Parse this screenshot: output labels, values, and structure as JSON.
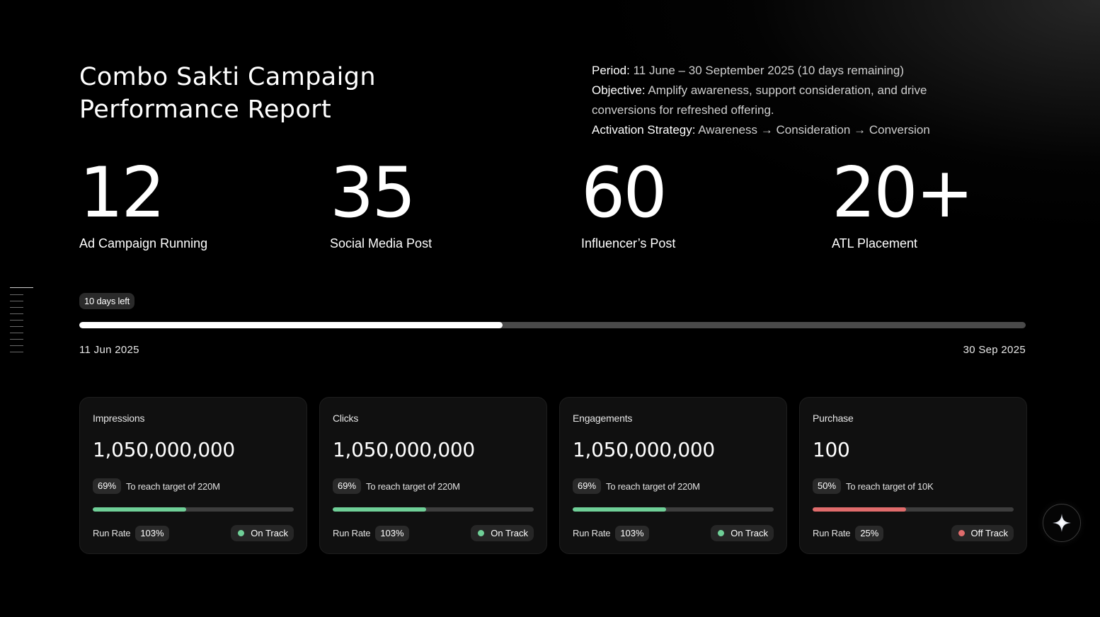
{
  "header": {
    "title_line1": "Combo Sakti Campaign",
    "title_line2": "Performance Report",
    "period_label": "Period:",
    "period_value": " 11 June – 30 September 2025 (10 days remaining)",
    "objective_label": "Objective:",
    "objective_value": " Amplify awareness, support consideration, and drive conversions for refreshed offering.",
    "strategy_label": "Activation Strategy:",
    "strategy_value": " Awareness → Consideration → Conversion"
  },
  "stats": [
    {
      "number": "12",
      "label": "Ad Campaign Running"
    },
    {
      "number": "35",
      "label": "Social Media Post"
    },
    {
      "number": "60",
      "label": "Influencer’s Post"
    },
    {
      "number": "20+",
      "label": "ATL Placement"
    }
  ],
  "timeline": {
    "days_left": "10 days left",
    "start_date": "11 Jun 2025",
    "end_date": "30 Sep 2025",
    "progress": 0.447
  },
  "cards": [
    {
      "title": "Impressions",
      "value": "1,050,000,000",
      "percent": "69%",
      "target": "To reach target of 220M",
      "progress": 0.465,
      "run_rate_label": "Run Rate",
      "run_rate": "103%",
      "status": "On Track",
      "color": "#6fcf97"
    },
    {
      "title": "Clicks",
      "value": "1,050,000,000",
      "percent": "69%",
      "target": "To reach target of 220M",
      "progress": 0.465,
      "run_rate_label": "Run Rate",
      "run_rate": "103%",
      "status": "On Track",
      "color": "#6fcf97"
    },
    {
      "title": "Engagements",
      "value": "1,050,000,000",
      "percent": "69%",
      "target": "To reach target of 220M",
      "progress": 0.465,
      "run_rate_label": "Run Rate",
      "run_rate": "103%",
      "status": "On Track",
      "color": "#6fcf97"
    },
    {
      "title": "Purchase",
      "value": "100",
      "percent": "50%",
      "target": "To reach target of 10K",
      "progress": 0.465,
      "run_rate_label": "Run Rate",
      "run_rate": "25%",
      "status": "Off Track",
      "color": "#e06c6c"
    }
  ],
  "assistant_button": {
    "icon": "sparkle-icon"
  }
}
